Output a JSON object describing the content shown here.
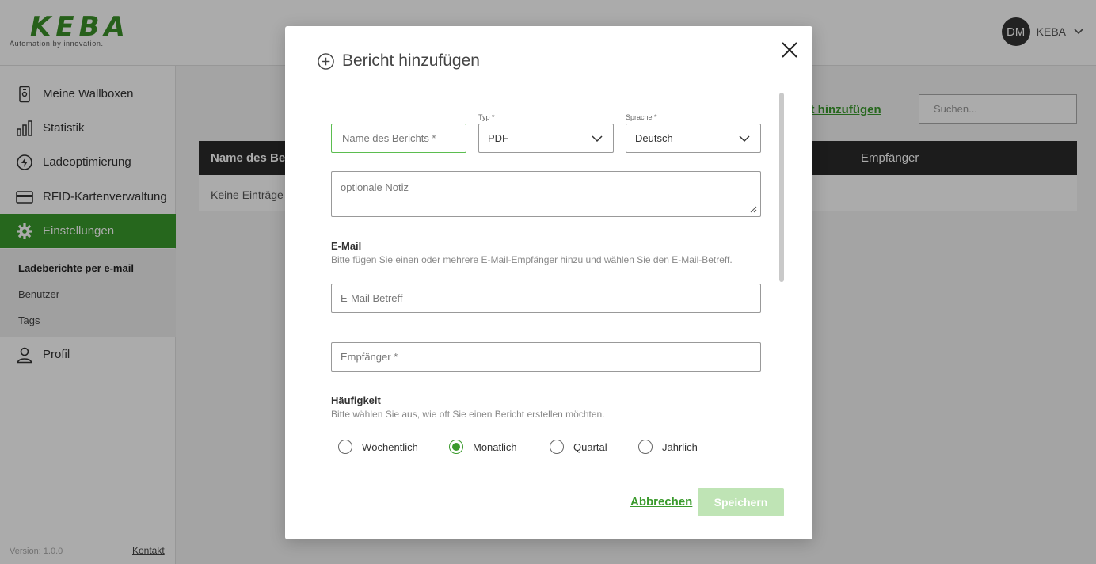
{
  "brand": {
    "name": "KEBA",
    "tagline": "Automation by innovation.",
    "accent": "#3a9a2c"
  },
  "user": {
    "initials": "DM",
    "name": "KEBA"
  },
  "sidebar": {
    "items": [
      {
        "label": "Meine Wallboxen",
        "icon": "wallbox-icon"
      },
      {
        "label": "Statistik",
        "icon": "bar-chart-icon"
      },
      {
        "label": "Ladeoptimierung",
        "icon": "charging-optimization-icon"
      },
      {
        "label": "RFID-Kartenverwaltung",
        "icon": "rfid-card-icon"
      },
      {
        "label": "Einstellungen",
        "icon": "gear-icon",
        "active": true
      },
      {
        "label": "Profil",
        "icon": "user-icon"
      }
    ],
    "sub_items": [
      "Ladeberichte per e-mail",
      "Benutzer",
      "Tags"
    ],
    "version": "Version: 1.0.0",
    "contact": "Kontakt"
  },
  "main": {
    "add_link": "richt hinzufügen",
    "search_placeholder": "Suchen...",
    "table": {
      "col_name": "Name des Ber",
      "col_recipients": "Empfänger",
      "empty_text": "Keine Einträge g"
    }
  },
  "modal": {
    "title": "Bericht hinzufügen",
    "name_placeholder": "Name des Berichts *",
    "type_label": "Typ *",
    "type_value": "PDF",
    "language_label": "Sprache *",
    "language_value": "Deutsch",
    "note_placeholder": "optionale Notiz",
    "email_section": {
      "title": "E-Mail",
      "description": "Bitte fügen Sie einen oder mehrere E-Mail-Empfänger hinzu und wählen Sie den E-Mail-Betreff.",
      "subject_placeholder": "E-Mail Betreff",
      "recipient_placeholder": "Empfänger *"
    },
    "frequency_section": {
      "title": "Häufigkeit",
      "description": "Bitte wählen Sie aus, wie oft Sie einen Bericht erstellen möchten.",
      "options": [
        "Wöchentlich",
        "Monatlich",
        "Quartal",
        "Jährlich"
      ],
      "selected": "Monatlich"
    },
    "cancel_label": "Abbrechen",
    "save_label": "Speichern"
  }
}
